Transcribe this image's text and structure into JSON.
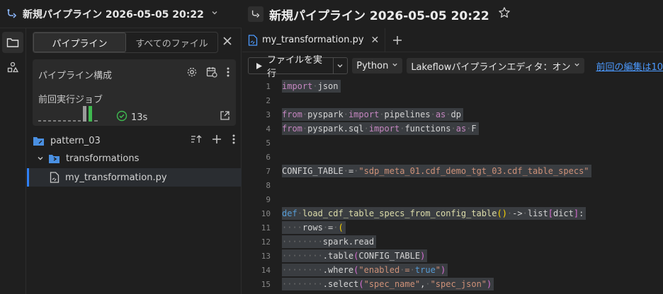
{
  "header": {
    "pipeline_title": "新規パイプライン 2026-05-05 20:22"
  },
  "panel": {
    "tabs": [
      "パイプライン",
      "すべてのファイル"
    ],
    "config_title": "パイプライン構成",
    "last_run_title": "前回実行ジョブ",
    "last_run_duration": "13s",
    "tree": {
      "root": "pattern_03",
      "folder": "transformations",
      "file": "my_transformation.py"
    }
  },
  "editor": {
    "title": "新規パイプライン 2026-05-05 20:22",
    "tab_label": "my_transformation.py",
    "run_button": "ファイルを実行",
    "language": "Python",
    "editor_mode": "Lakeflowパイプラインエディタ：オン",
    "last_edit": "前回の編集は10"
  },
  "colors": {
    "accent": "#2f81f7",
    "success": "#3fb950",
    "link": "#4c9aff"
  },
  "code": [
    {
      "n": "1",
      "t": "import json"
    },
    {
      "n": "2",
      "t": ""
    },
    {
      "n": "3",
      "t": "from pyspark import pipelines as dp"
    },
    {
      "n": "4",
      "t": "from pyspark.sql import functions as F"
    },
    {
      "n": "5",
      "t": ""
    },
    {
      "n": "6",
      "t": ""
    },
    {
      "n": "7",
      "t": "CONFIG_TABLE = \"sdp_meta_01.cdf_demo_tgt_03.cdf_table_specs\""
    },
    {
      "n": "8",
      "t": ""
    },
    {
      "n": "9",
      "t": ""
    },
    {
      "n": "10",
      "t": "def load_cdf_table_specs_from_config_table() -> list[dict]:"
    },
    {
      "n": "11",
      "t": "    rows = ("
    },
    {
      "n": "12",
      "t": "        spark.read"
    },
    {
      "n": "13",
      "t": "        .table(CONFIG_TABLE)"
    },
    {
      "n": "14",
      "t": "        .where(\"enabled = true\")"
    },
    {
      "n": "15",
      "t": "        .select(\"spec_name\", \"spec_json\")"
    }
  ]
}
